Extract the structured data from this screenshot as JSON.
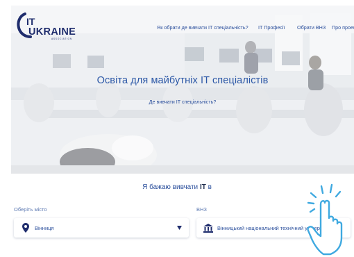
{
  "header": {
    "logo_top": "IT",
    "logo_main": "UKRAINE",
    "logo_sub": "ASSOCIATION",
    "nav": [
      {
        "label": "Як обрати де вивчати IT спеціальність?"
      },
      {
        "label": "IT Професії"
      },
      {
        "label": "Обрати ВНЗ"
      },
      {
        "label": "Про проект"
      }
    ]
  },
  "hero": {
    "title": "Освіта для майбутніх IT спеціалістів",
    "subtitle": "Де вивчати IT спеціальність?"
  },
  "search": {
    "prompt_prefix": "Я бажаю вивчати",
    "prompt_bold": "IT",
    "prompt_suffix": "в",
    "city_label": "Оберіть місто",
    "city_value": "Вінниця",
    "uni_label": "ВНЗ",
    "uni_value": "Вінницький національний технічний університет"
  },
  "colors": {
    "accent": "#2b4f9c",
    "title": "#2b57a6",
    "logo_navy": "#1f2d6d",
    "pointer": "#3fa9e0"
  }
}
